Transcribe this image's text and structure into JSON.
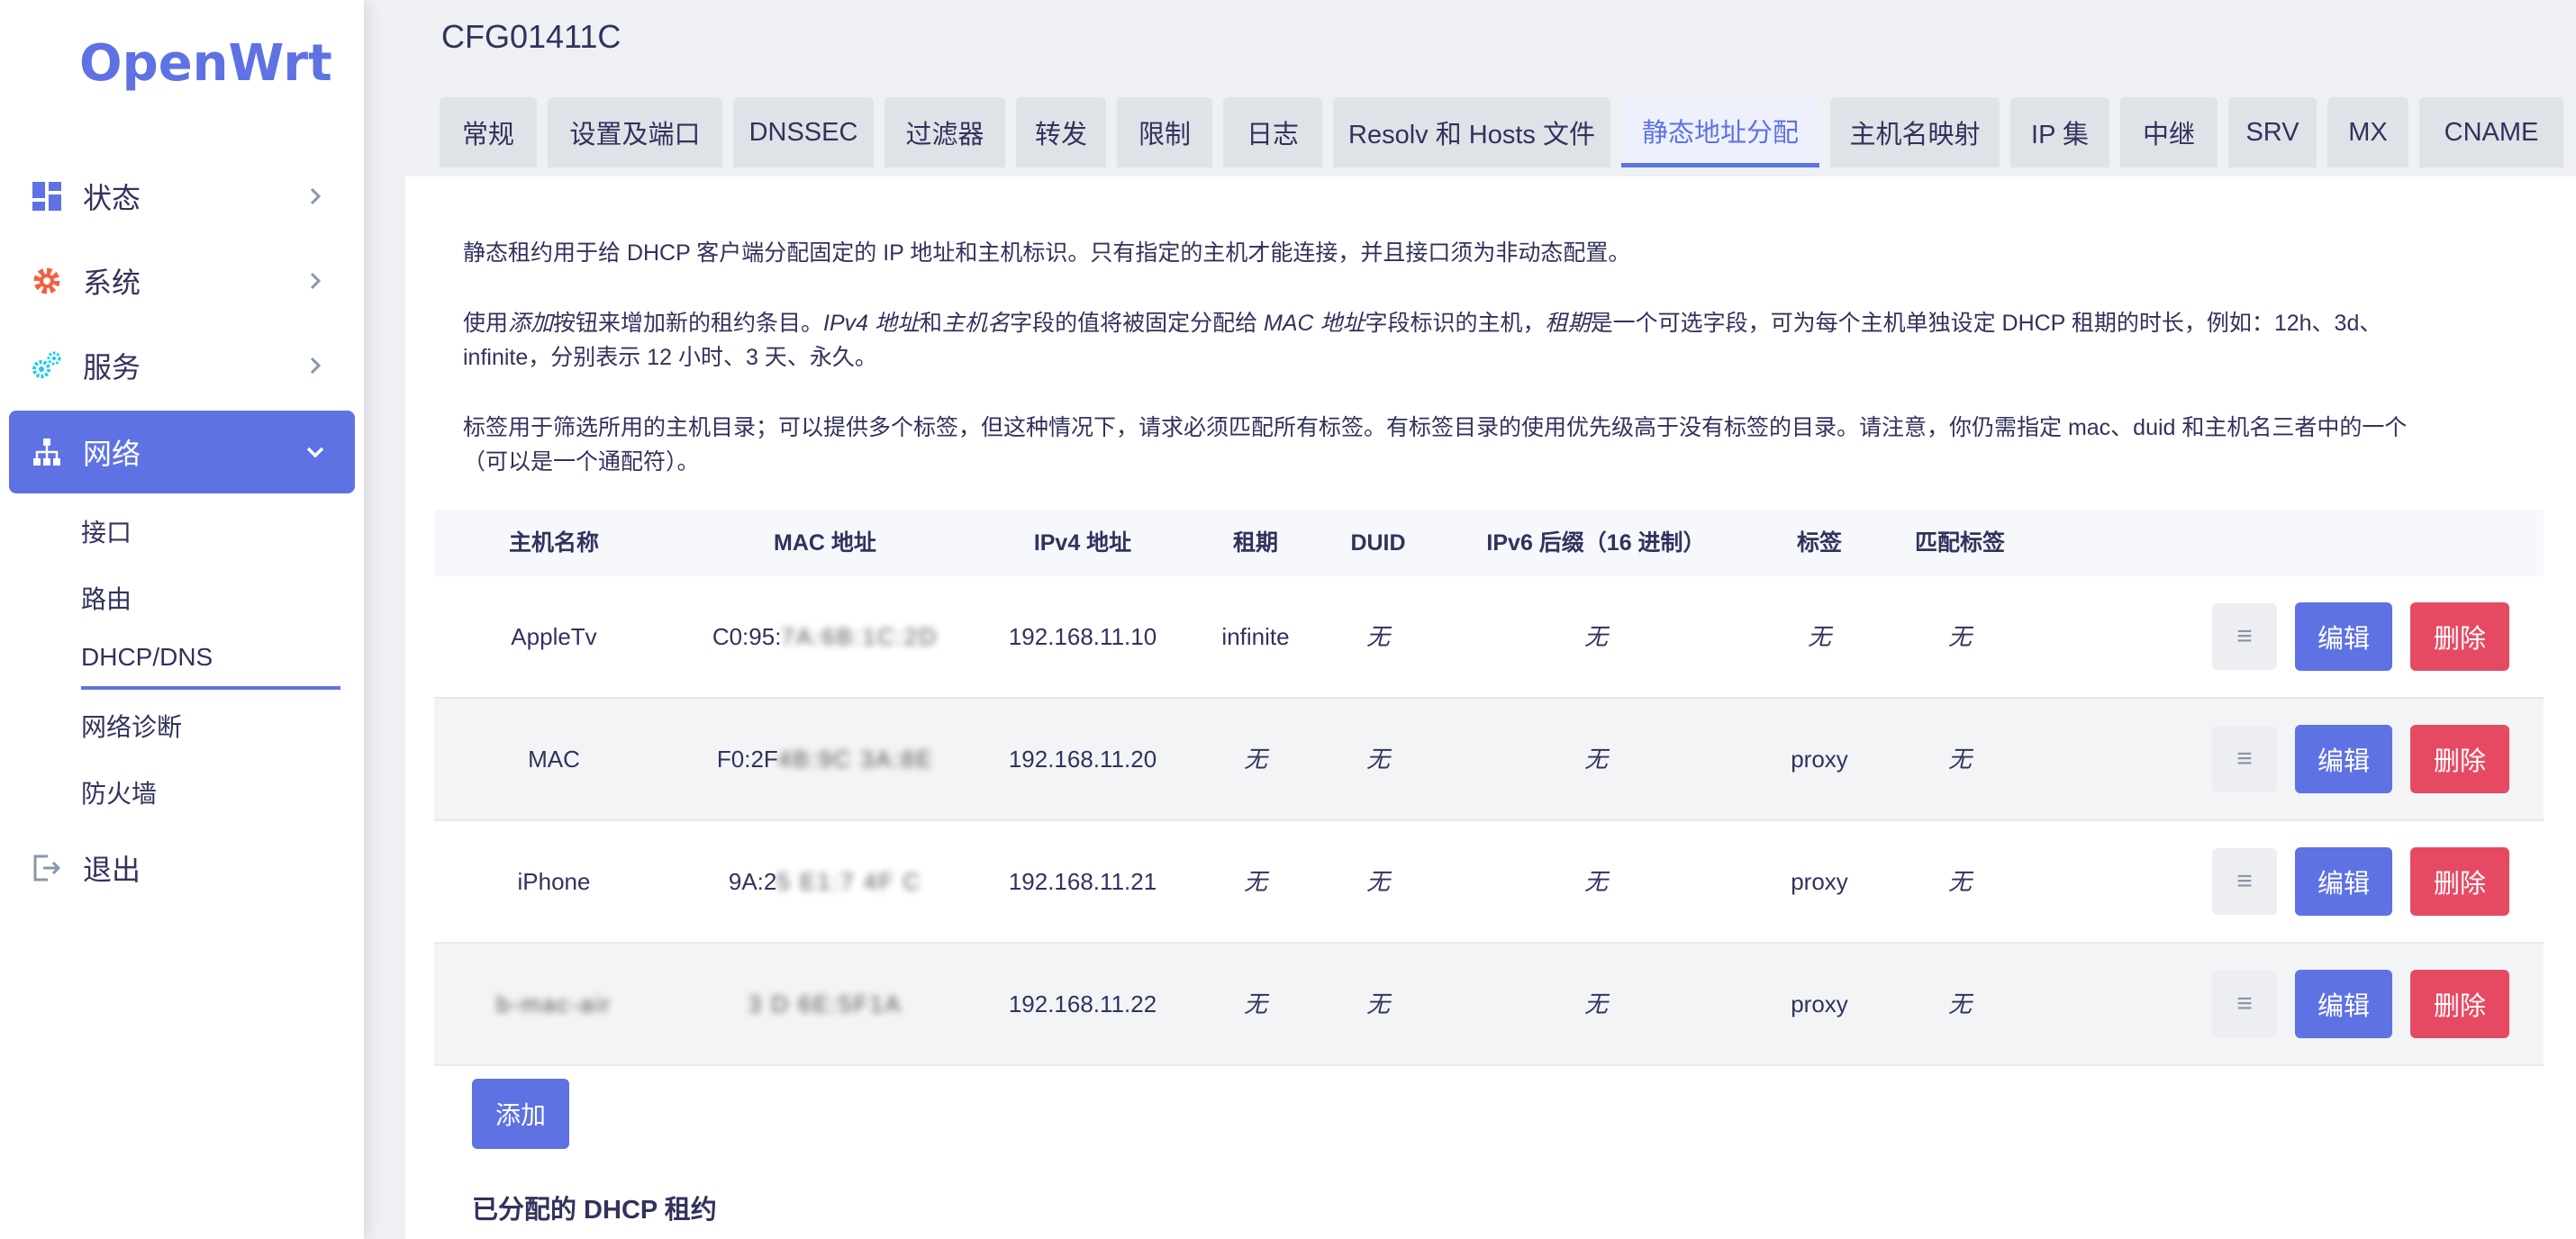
{
  "sidebar": {
    "logo": "OpenWrt",
    "items": [
      {
        "label": "状态",
        "icon": "dashboard-icon"
      },
      {
        "label": "系统",
        "icon": "gear-icon"
      },
      {
        "label": "服务",
        "icon": "cogs-icon"
      },
      {
        "label": "网络",
        "icon": "network-icon"
      }
    ],
    "sub_items": [
      "接口",
      "路由",
      "DHCP/DNS",
      "网络诊断",
      "防火墙"
    ],
    "logout": "退出"
  },
  "page": {
    "title": "CFG01411C",
    "tabs": [
      "常规",
      "设置及端口",
      "DNSSEC",
      "过滤器",
      "转发",
      "限制",
      "日志",
      "Resolv 和 Hosts 文件",
      "静态地址分配",
      "主机名映射",
      "IP 集",
      "中继",
      "SRV",
      "MX",
      "CNAME"
    ],
    "active_tab": "静态地址分配"
  },
  "description": {
    "p1": "静态租约用于给 DHCP 客户端分配固定的 IP 地址和主机标识。只有指定的主机才能连接，并且接口须为非动态配置。",
    "p2_a": "使用",
    "p2_b": "添加",
    "p2_c": "按钮来增加新的租约条目。",
    "p2_d": "IPv4 地址",
    "p2_e": "和",
    "p2_f": "主机名",
    "p2_g": "字段的值将被固定分配给 ",
    "p2_h": "MAC 地址",
    "p2_i": "字段标识的主机，",
    "p2_j": "租期",
    "p2_k": "是一个可选字段，可为每个主机单独设定 DHCP 租期的时长，例如：12h、3d、",
    "p2_l": "infinite，分别表示 12 小时、3 天、永久。",
    "p3_a": "标签用于筛选所用的主机目录；可以提供多个标签，但这种情况下，请求必须匹配所有标签。有标签目录的使用优先级高于没有标签的目录。请注意，你仍需指定 mac、duid 和主机名三者中的一个",
    "p3_b": "（可以是一个通配符）。"
  },
  "table": {
    "headers": [
      "主机名称",
      "MAC 地址",
      "IPv4 地址",
      "租期",
      "DUID",
      "IPv6 后缀（16 进制）",
      "标签",
      "匹配标签"
    ],
    "rows": [
      {
        "hostname": "AppleTv",
        "mac": "C0:95:",
        "mac_hidden": "7A:6B:1C:2D",
        "ipv4": "192.168.11.10",
        "lease": "infinite",
        "duid": "无",
        "ipv6": "无",
        "tag": "无",
        "match": "无"
      },
      {
        "hostname": "MAC",
        "mac": "F0:2F",
        "mac_hidden": "4B:9C  3A:8E",
        "ipv4": "192.168.11.20",
        "lease": "无",
        "duid": "无",
        "ipv6": "无",
        "tag": "proxy",
        "match": "无"
      },
      {
        "hostname": "iPhone",
        "mac": "9A:2",
        "mac_hidden": "5 E1:7  4F  C",
        "ipv4": "192.168.11.21",
        "lease": "无",
        "duid": "无",
        "ipv6": "无",
        "tag": "proxy",
        "match": "无"
      },
      {
        "hostname": "",
        "hostname_hidden": "b-mac-air",
        "mac": "",
        "mac_hidden": "3  D  6E:5F1A",
        "ipv4": "192.168.11.22",
        "lease": "无",
        "duid": "无",
        "ipv6": "无",
        "tag": "proxy",
        "match": "无"
      }
    ],
    "drag_label": "≡",
    "edit_label": "编辑",
    "delete_label": "删除"
  },
  "add_label": "添加",
  "section_title": "已分配的 DHCP 租约",
  "colors": {
    "accent": "#5e72e4",
    "danger": "#e64a62"
  }
}
